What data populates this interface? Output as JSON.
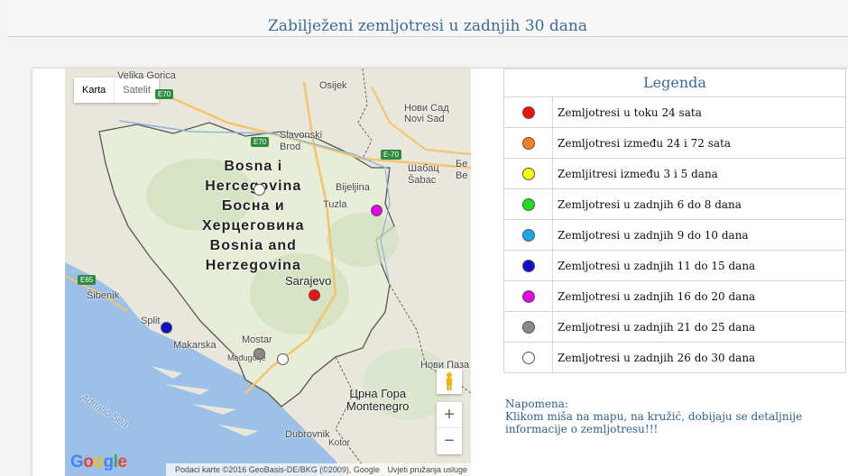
{
  "page": {
    "title": "Zabilježeni zemljotresi u zadnjih 30 dana"
  },
  "map": {
    "type_control": {
      "map": "Karta",
      "satellite": "Satelit"
    },
    "places": {
      "velika_gorica": "Velika Gorica",
      "osijek": "Osijek",
      "slavonski_brod": "Slavonski\nBrod",
      "novi_sad": "Novi Sad",
      "novi_sad_cyr": "Нови Сад",
      "shabac": "Шабац\nŠabac",
      "bel": "Бе\nBe",
      "country_label": "Bosna i\nHercegovina\nБосна и\nХерцеговина\nBosnia and\nHerzegovina",
      "bijeljina": "Bijeljina",
      "tuzla": "Tuzla",
      "sarajevo": "Sarajevo",
      "sibenik": "Šibenik",
      "split": "Split",
      "makarska": "Makarska",
      "mostar": "Mostar",
      "medugorje": "Međugorje",
      "novi_pazar": "Нови Паза",
      "montenegro": "Црна Гора\nMontenegro",
      "dubrovnik": "Dubrovnik",
      "kotor": "Kotor",
      "adriatic": "Adriatic Sea"
    },
    "roads": {
      "e70_top": "E70",
      "e70": "E70",
      "e70_east": "E-70",
      "e65": "E65"
    },
    "zoom": {
      "in": "+",
      "out": "−"
    },
    "logo": "Google",
    "attribution": {
      "data": "Podaci karte ©2016 GeoBasis-DE/BKG (©2009), Google",
      "terms": "Uvjeti pružanja usluge"
    },
    "markers": [
      {
        "name": "red",
        "color": "#ee1111",
        "lat": 43.8,
        "lon": 18.4
      },
      {
        "name": "magenta",
        "color": "#e600e6",
        "lat": 44.6,
        "lon": 19.2
      },
      {
        "name": "blue",
        "color": "#1010cc",
        "lat": 43.5,
        "lon": 16.5
      },
      {
        "name": "gray",
        "color": "#8a8a8a",
        "lat": 43.25,
        "lon": 17.7
      },
      {
        "name": "white-mostar",
        "color": "#ffffff",
        "lat": 43.2,
        "lon": 18.0
      },
      {
        "name": "white-north",
        "color": "#ffffff",
        "lat": 44.8,
        "lon": 17.7
      }
    ]
  },
  "legend": {
    "title": "Legenda",
    "items": [
      {
        "color": "#ee1111",
        "label": "Zemljotresi u toku 24 sata"
      },
      {
        "color": "#ff7f1a",
        "label": "Zemljotresi između 24 i 72 sata"
      },
      {
        "color": "#ffff00",
        "label": "Zemljitresi između 3 i 5 dana"
      },
      {
        "color": "#1be01b",
        "label": "Zemljotresi u zadnjih 6 do 8 dana"
      },
      {
        "color": "#1aa9e8",
        "label": "Zemljotresi u zadnjih 9 do 10 dana"
      },
      {
        "color": "#1010cc",
        "label": "Zemljotresi u zadnjih 11 do 15 dana"
      },
      {
        "color": "#e600e6",
        "label": "Zemljotresi u zadnjih 16 do 20 dana"
      },
      {
        "color": "#8a8a8a",
        "label": "Zemljotresi u zadnjih 21 do 25 dana"
      },
      {
        "color": "#ffffff",
        "label": "Zemljotresi u zadnjih 26 do 30 dana"
      }
    ]
  },
  "note": {
    "heading": "Napomena:",
    "text": "Klikom miša na mapu, na kružić, dobijaju se detaljnije informacije o zemljotresu!!!"
  }
}
